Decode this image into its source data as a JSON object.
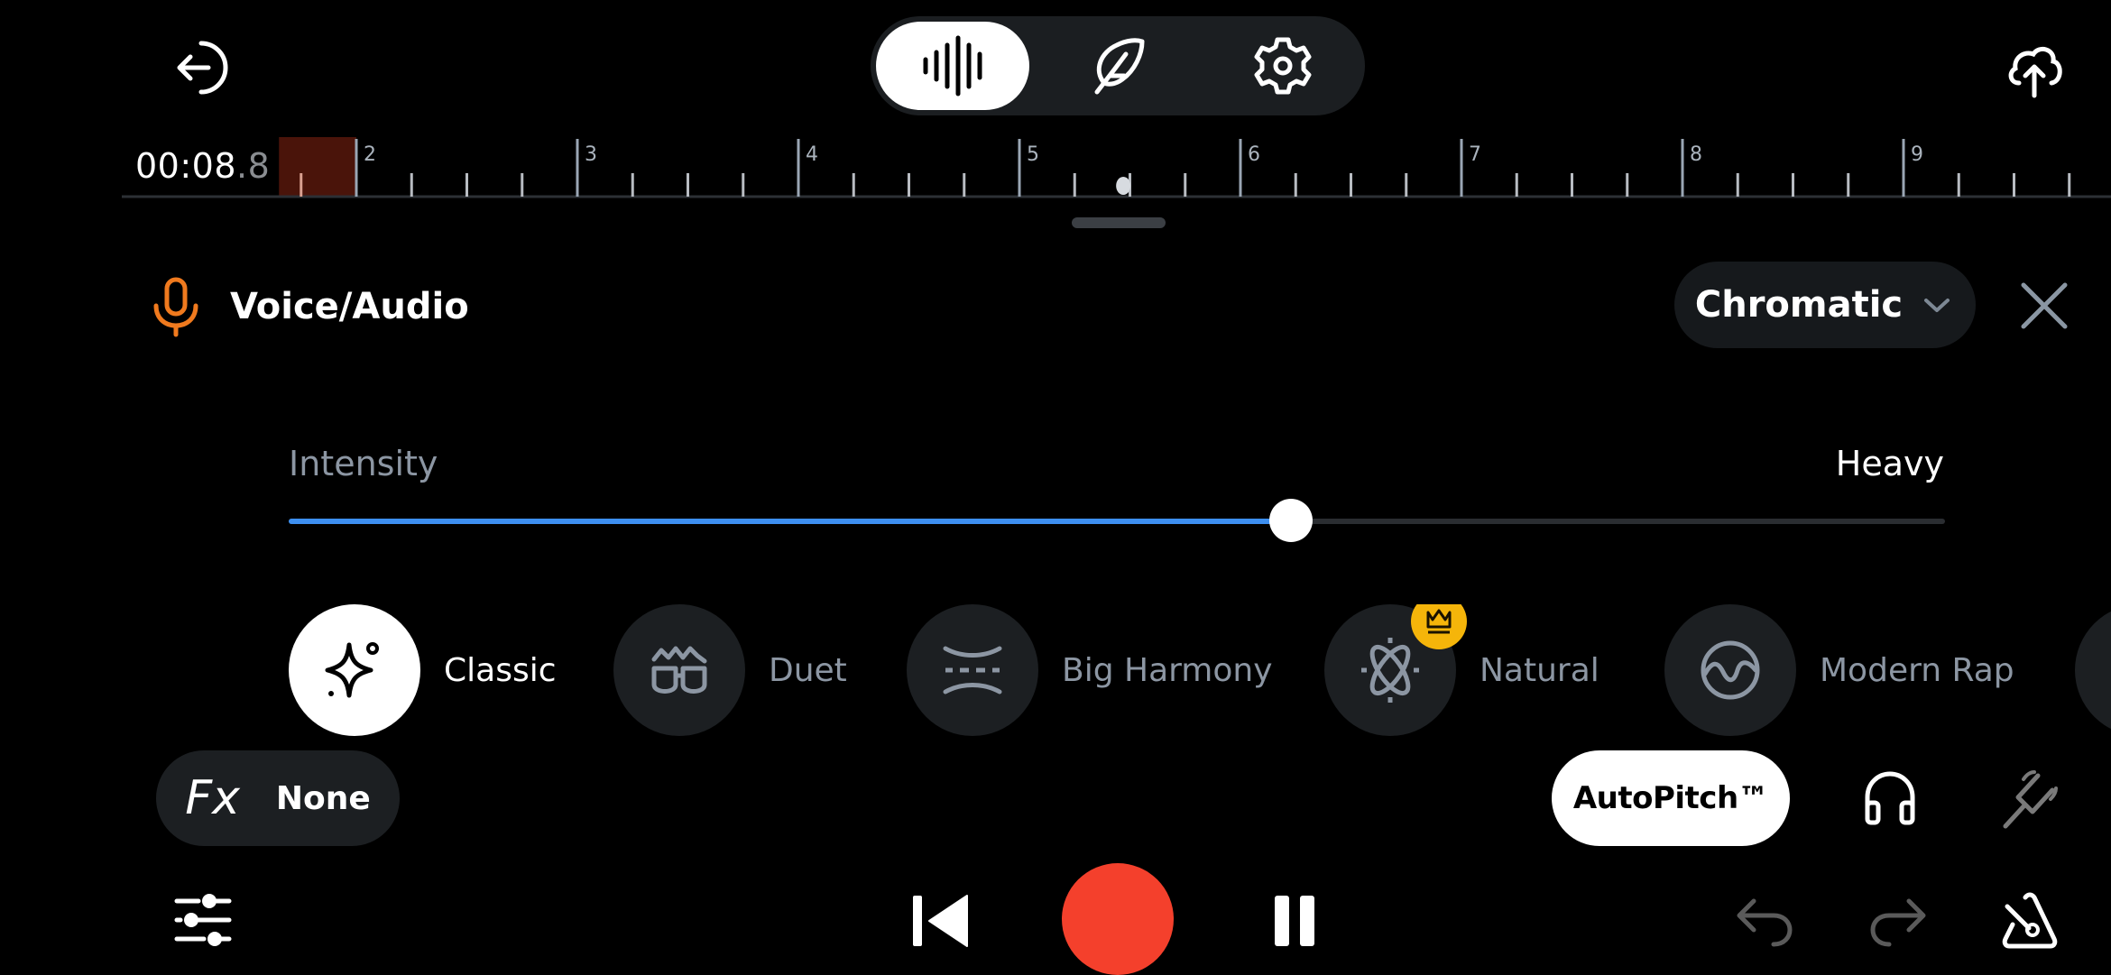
{
  "colors": {
    "background": "#000000",
    "accent_blue": "#3d8ff0",
    "record_red": "#f4402c",
    "mic_orange": "#f07a1e",
    "premium_gold": "#f5b50a",
    "loop_region": "#4a140a",
    "muted_text": "#8c96a3"
  },
  "top_bar": {
    "back_icon": "exit-arrow-icon",
    "modes": [
      {
        "name": "audio",
        "icon": "waveform-icon",
        "active": true
      },
      {
        "name": "lyrics",
        "icon": "feather-icon",
        "active": false
      },
      {
        "name": "settings",
        "icon": "gear-icon",
        "active": false
      }
    ],
    "upload_icon": "cloud-upload-icon"
  },
  "timeline": {
    "timecode_main": "00:08",
    "timecode_frac": ".8",
    "bar_labels": [
      "2",
      "3",
      "4",
      "5",
      "6",
      "7",
      "8",
      "9"
    ],
    "ticks_per_bar": 4,
    "loop_region_bars": [
      1.65,
      2.0
    ],
    "playhead_bar": 5.47
  },
  "track": {
    "title": "Voice/Audio",
    "icon": "microphone-icon",
    "scale": "Chromatic",
    "close_icon": "close-icon"
  },
  "intensity": {
    "label": "Intensity",
    "value_label": "Heavy",
    "value": 0.605
  },
  "presets": [
    {
      "label": "Classic",
      "icon": "sparkle-icon",
      "active": true,
      "premium": false
    },
    {
      "label": "Duet",
      "icon": "duet-glasses-icon",
      "active": false,
      "premium": false
    },
    {
      "label": "Big Harmony",
      "icon": "harmony-icon",
      "active": false,
      "premium": false
    },
    {
      "label": "Natural",
      "icon": "atom-icon",
      "active": false,
      "premium": true
    },
    {
      "label": "Modern Rap",
      "icon": "wave-circle-icon",
      "active": false,
      "premium": false
    },
    {
      "label": "",
      "icon": "more-preset-icon",
      "active": false,
      "premium": false
    }
  ],
  "fx": {
    "label": "Fx",
    "value": "None"
  },
  "autopitch": {
    "label": "AutoPitch™"
  },
  "controls": {
    "headphones_icon": "headphones-icon",
    "tuner_icon": "tuning-fork-icon",
    "mixer_icon": "sliders-icon",
    "skip_back_icon": "skip-back-icon",
    "record_icon": "record-icon",
    "pause_icon": "pause-icon",
    "undo_icon": "undo-icon",
    "redo_icon": "redo-icon",
    "metronome_icon": "metronome-icon"
  }
}
